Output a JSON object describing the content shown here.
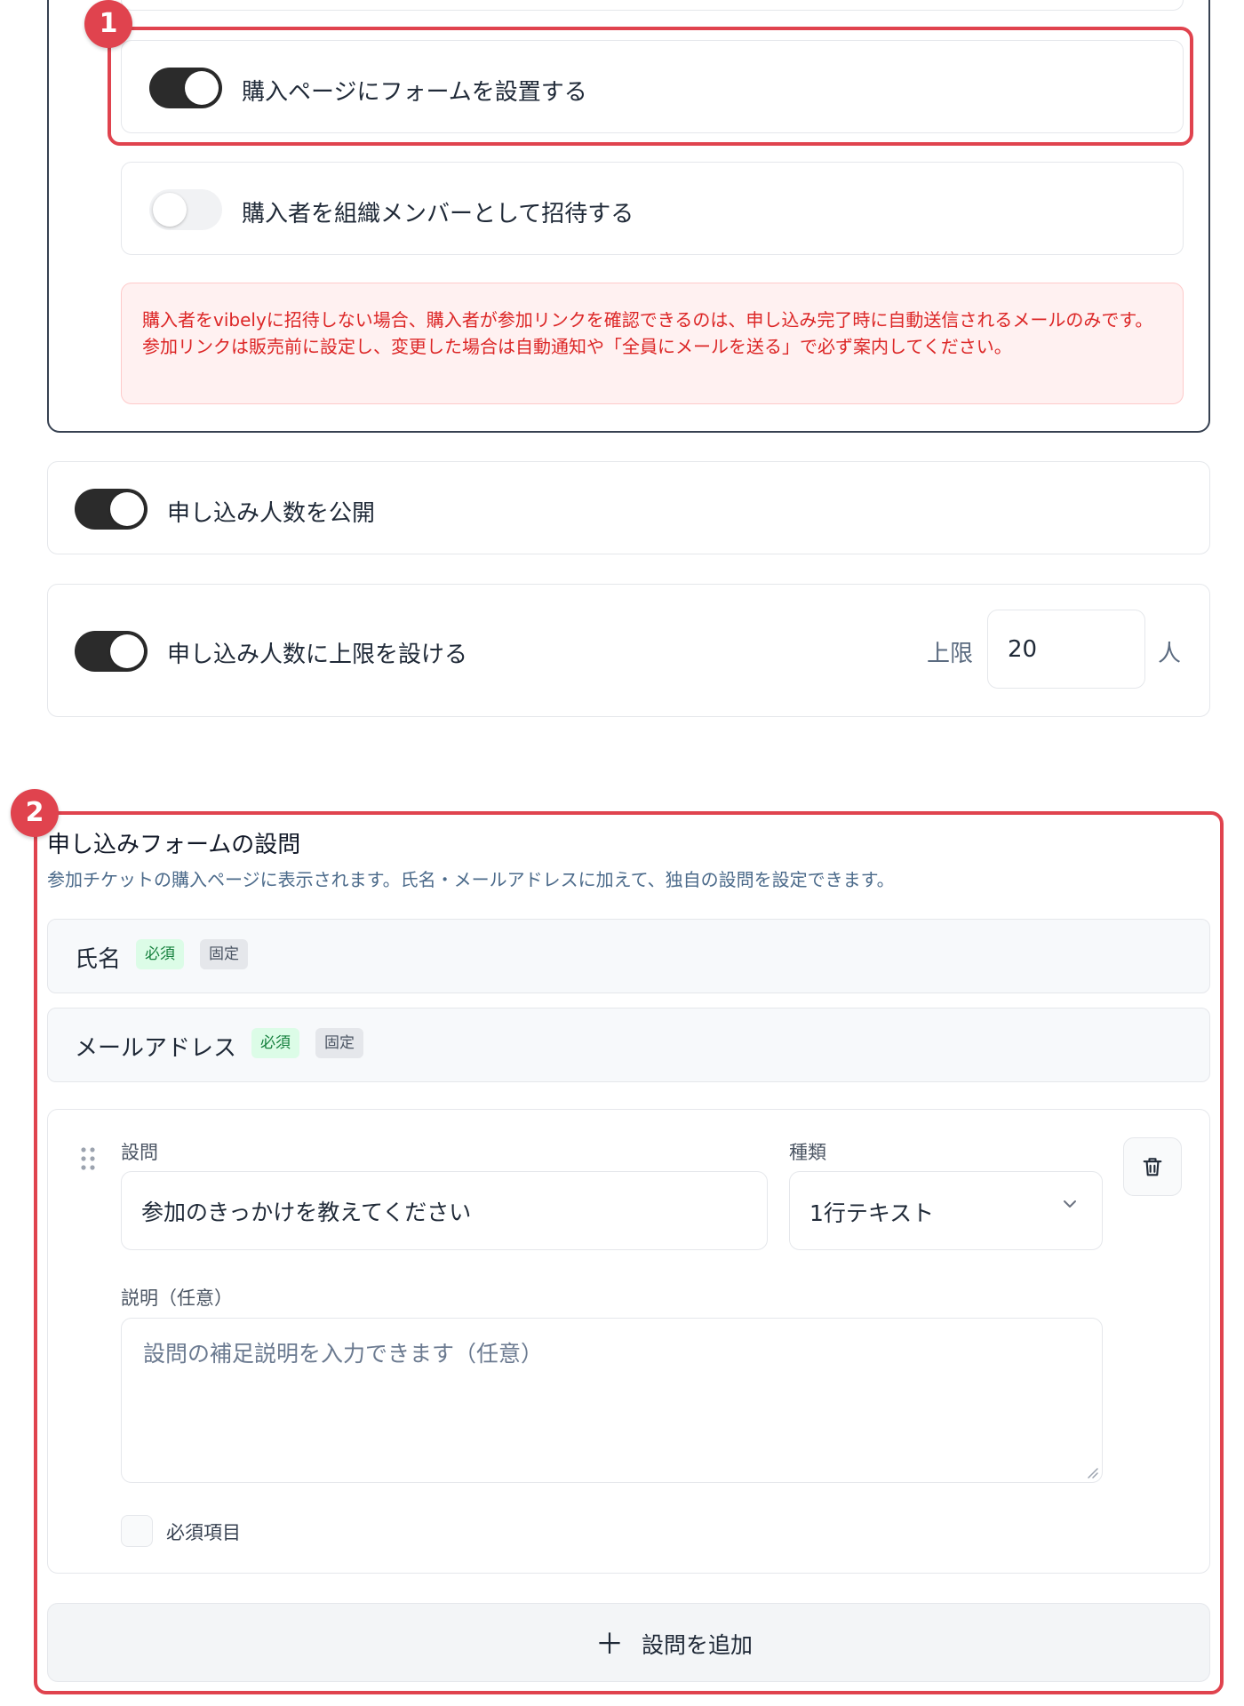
{
  "colors": {
    "accent": "#e0434e",
    "toggle_on": "#2b2b2b",
    "alert_text": "#dc2626",
    "required_badge": "#15803d"
  },
  "callouts": {
    "one": "1",
    "two": "2"
  },
  "form_settings": {
    "place_form_label": "購入ページにフォームを設置する",
    "place_form_on": true,
    "invite_members_label": "購入者を組織メンバーとして招待する",
    "invite_members_on": false,
    "alert_text": "購入者をvibelyに招待しない場合、購入者が参加リンクを確認できるのは、申し込み完了時に自動送信されるメールのみです。参加リンクは販売前に設定し、変更した場合は自動通知や「全員にメールを送る」で必ず案内してください。"
  },
  "applicants": {
    "public_count_label": "申し込み人数を公開",
    "public_count_on": true,
    "limit_label": "申し込み人数に上限を設ける",
    "limit_on": true,
    "limit_prefix": "上限",
    "limit_value": "20",
    "limit_unit": "人"
  },
  "questions": {
    "title": "申し込みフォームの設問",
    "description": "参加チケットの購入ページに表示されます。氏名・メールアドレスに加えて、独自の設問を設定できます。",
    "fixed_fields": [
      {
        "name": "氏名",
        "required_badge": "必須",
        "fixed_badge": "固定"
      },
      {
        "name": "メールアドレス",
        "required_badge": "必須",
        "fixed_badge": "固定"
      }
    ],
    "custom_question": {
      "question_label": "設問",
      "question_value": "参加のきっかけを教えてください",
      "type_label": "種類",
      "type_value": "1行テキスト",
      "description_label": "説明（任意）",
      "description_placeholder": "設問の補足説明を入力できます（任意）",
      "required_label": "必須項目",
      "required_checked": false
    },
    "add_button_icon": "plus-icon",
    "add_button_label": "設問を追加"
  }
}
